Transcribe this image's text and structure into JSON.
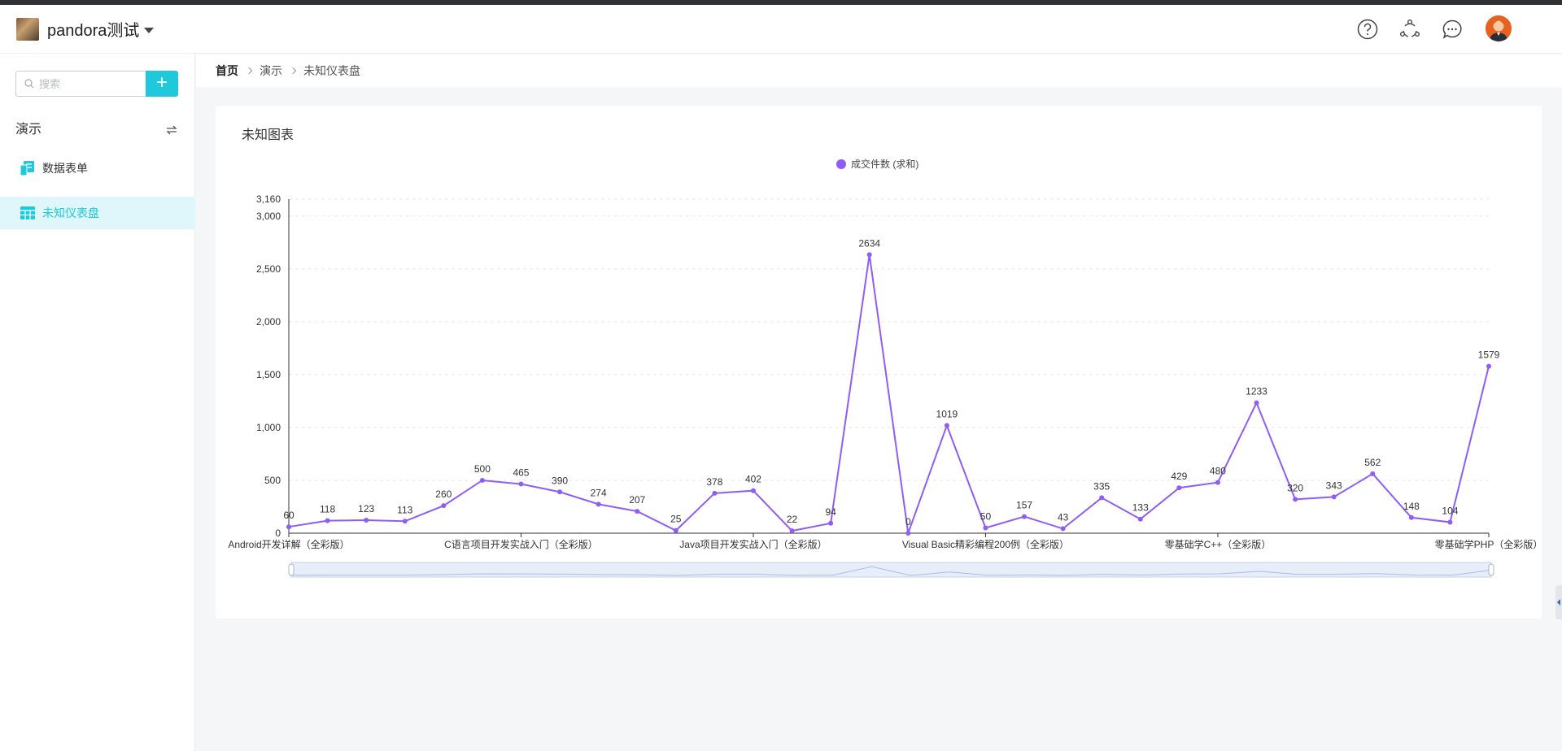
{
  "header": {
    "app_name": "pandora测试",
    "icons": [
      "help-icon",
      "share-icon",
      "message-icon"
    ]
  },
  "sidebar": {
    "search_placeholder": "搜索",
    "add_label": "+",
    "group_label": "演示",
    "items": [
      {
        "label": "数据表单",
        "icon": "form-icon",
        "active": false
      },
      {
        "label": "未知仪表盘",
        "icon": "table-icon",
        "active": true
      }
    ]
  },
  "breadcrumb": [
    "首页",
    "演示",
    "未知仪表盘"
  ],
  "card": {
    "title": "未知图表"
  },
  "colors": {
    "accent": "#1fc8db",
    "series": "#8f5cf7"
  },
  "chart_data": {
    "type": "line",
    "series": [
      {
        "name": "成交件数 (求和)",
        "values": [
          60,
          118,
          123,
          113,
          260,
          500,
          465,
          390,
          274,
          207,
          25,
          378,
          402,
          22,
          94,
          2634,
          0,
          1019,
          50,
          157,
          43,
          335,
          133,
          429,
          480,
          1233,
          320,
          343,
          562,
          148,
          104,
          1579
        ]
      }
    ],
    "category_labels": [
      {
        "index": 0,
        "label": "Android开发详解（全彩版）"
      },
      {
        "index": 6,
        "label": "C语言项目开发实战入门（全彩版）"
      },
      {
        "index": 12,
        "label": "Java项目开发实战入门（全彩版）"
      },
      {
        "index": 18,
        "label": "Visual Basic精彩编程200例（全彩版）"
      },
      {
        "index": 24,
        "label": "零基础学C++（全彩版）"
      },
      {
        "index": 31,
        "label": "零基础学PHP（全彩版）"
      }
    ],
    "y_ticks": [
      "0",
      "500",
      "1,000",
      "1,500",
      "2,000",
      "2,500",
      "3,000",
      "3,160"
    ],
    "ylim": [
      0,
      3160
    ],
    "legend_position": "top-center",
    "grid": true,
    "data_labels": true,
    "data_zoom": true
  }
}
